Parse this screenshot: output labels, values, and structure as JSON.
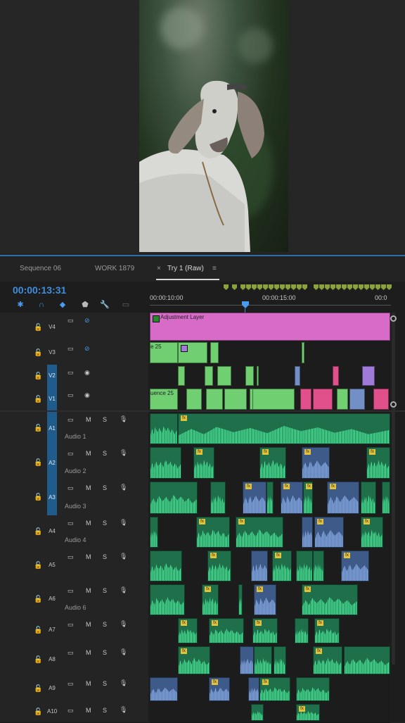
{
  "preview": {
    "alt": "goat video frame"
  },
  "tabs": [
    {
      "label": "Sequence 06"
    },
    {
      "label": "WORK 1879"
    },
    {
      "label": "Try 1 (Raw)",
      "active": true
    }
  ],
  "tab_close": "×",
  "tab_menu": "≡",
  "timecode": "00:00:13:31",
  "ruler": {
    "labels": [
      "00:00:10:00",
      "00:00:15:00",
      "00:0"
    ]
  },
  "clips": {
    "adjustment_layer": "Adjustment Layer",
    "seq_a": "e 25",
    "seq_b": "uence 25"
  },
  "fx_badge": "fx",
  "tracks": {
    "video": [
      {
        "id": "V4",
        "selected": false,
        "eye_off": true
      },
      {
        "id": "V3",
        "selected": false,
        "eye_off": true
      },
      {
        "id": "V2",
        "selected": true,
        "eye_off": false
      },
      {
        "id": "V1",
        "selected": true,
        "eye_off": false
      }
    ],
    "audio": [
      {
        "id": "A1",
        "name": "Audio 1",
        "selected": true
      },
      {
        "id": "A2",
        "name": "Audio 2",
        "selected": true
      },
      {
        "id": "A3",
        "name": "Audio 3",
        "selected": true
      },
      {
        "id": "A4",
        "name": "Audio 4",
        "selected": false
      },
      {
        "id": "A5",
        "name": "",
        "selected": false
      },
      {
        "id": "A6",
        "name": "Audio 6",
        "selected": false
      },
      {
        "id": "A7",
        "name": "",
        "selected": false
      },
      {
        "id": "A8",
        "name": "",
        "selected": false
      },
      {
        "id": "A9",
        "name": "",
        "selected": false
      },
      {
        "id": "A10",
        "name": "",
        "selected": false
      }
    ],
    "mute_label": "M",
    "solo_label": "S"
  },
  "colors": {
    "accent": "#3d8fe0",
    "video_clip": "#6fcf71",
    "adjustment": "#d86bc8",
    "audio_clip": "#2aa868"
  }
}
